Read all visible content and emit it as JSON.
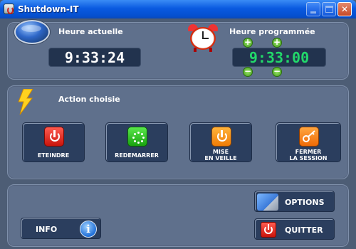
{
  "window": {
    "title": "Shutdown-IT",
    "controls": [
      "minimize",
      "maximize",
      "close"
    ]
  },
  "time_panel": {
    "current_label": "Heure actuelle",
    "current_time": "9:33:24",
    "scheduled_label": "Heure programmée",
    "scheduled_time": "9:33:00",
    "increment": "+",
    "decrement": "−"
  },
  "action_panel": {
    "label": "Action choisie",
    "actions": [
      {
        "label": "ETEINDRE",
        "icon": "power-icon",
        "color": "#e0241a"
      },
      {
        "label": "REDEMARRER",
        "icon": "restart-icon",
        "color": "#2fc322"
      },
      {
        "label_line1": "MISE",
        "label_line2": "EN VEILLE",
        "icon": "standby-icon",
        "color": "#f7941d"
      },
      {
        "label_line1": "FERMER",
        "label_line2": "LA SESSION",
        "icon": "key-icon",
        "color": "#f47b20"
      }
    ]
  },
  "bottom": {
    "options_label": "OPTIONS",
    "quit_label": "QUITTER",
    "info_label": "INFO",
    "info_glyph": "i"
  },
  "colors": {
    "background": "#4d5d75",
    "panel": "#5f708c",
    "display_bg": "#22334e",
    "scheduled_digits": "#22d86a",
    "titlebar": "#0a5ae0"
  }
}
